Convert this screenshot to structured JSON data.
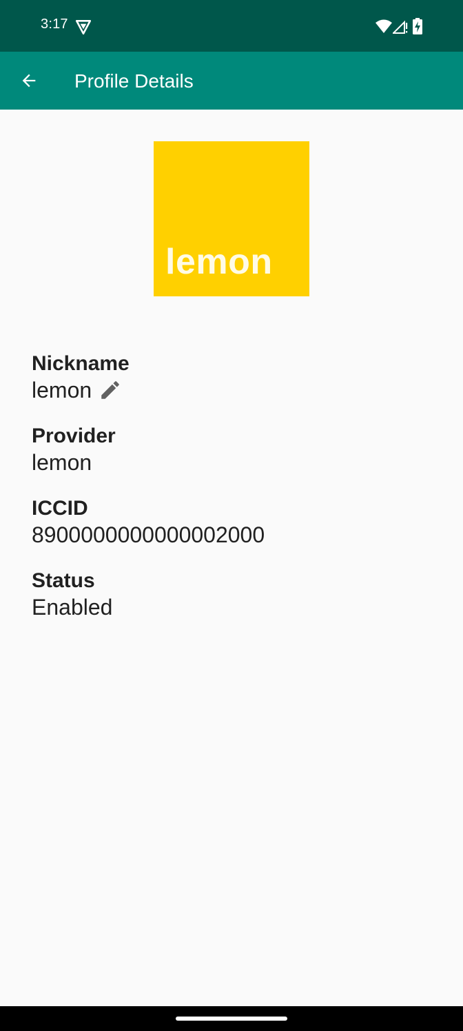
{
  "status_bar": {
    "time": "3:17",
    "icons": [
      "vpn-icon",
      "wifi-icon",
      "signal-icon",
      "battery-charging-icon"
    ]
  },
  "app_bar": {
    "title": "Profile Details",
    "back_icon": "arrow-back-icon",
    "color": "#00897b"
  },
  "logo": {
    "text": "lemon",
    "color": "#ffd000"
  },
  "fields": {
    "nickname": {
      "label": "Nickname",
      "value": "lemon",
      "edit_icon": "pencil-icon"
    },
    "provider": {
      "label": "Provider",
      "value": "lemon"
    },
    "iccid": {
      "label": "ICCID",
      "value": "8900000000000002000"
    },
    "status": {
      "label": "Status",
      "value": "Enabled"
    }
  },
  "colors": {
    "status_bar": "#00574b",
    "background": "#fafafa",
    "text": "#212121"
  }
}
